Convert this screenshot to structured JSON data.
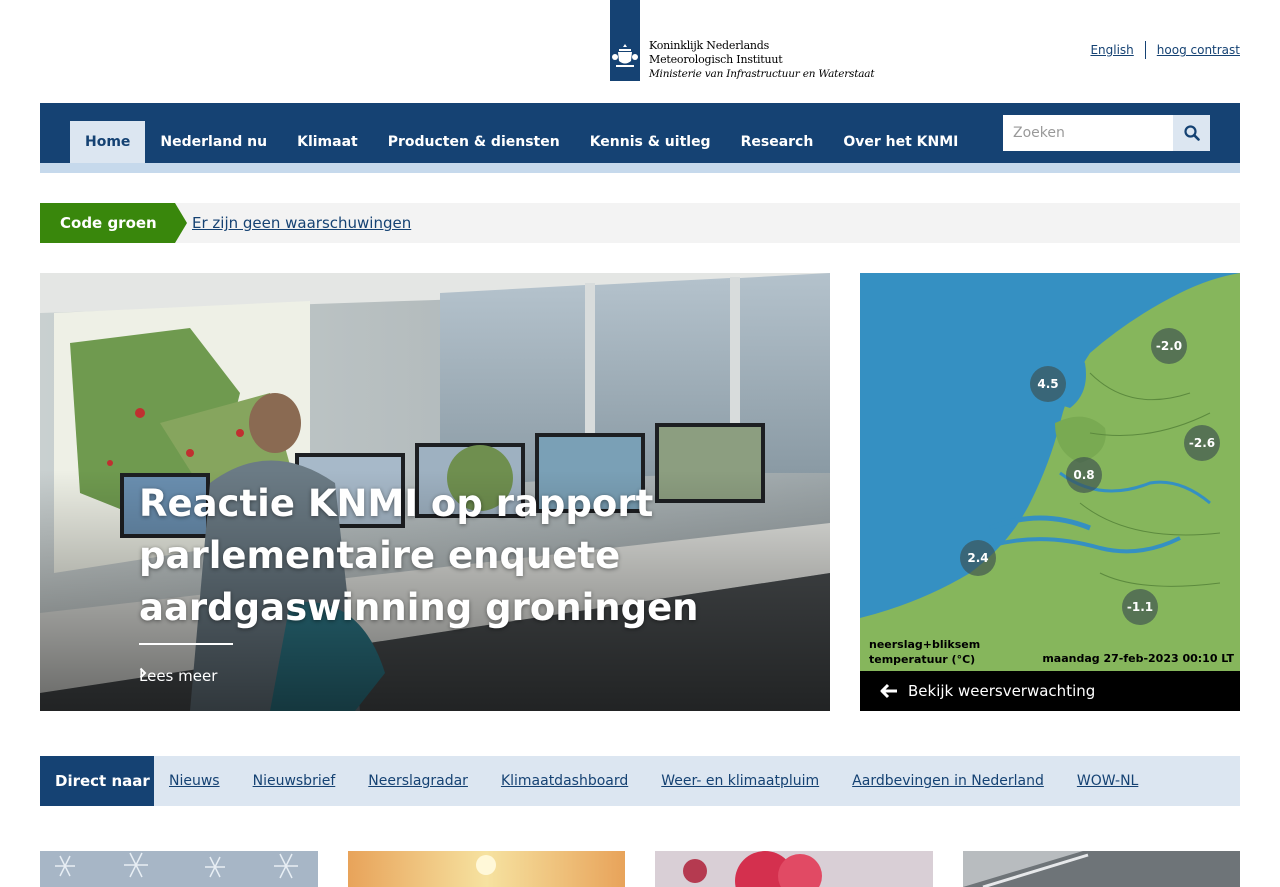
{
  "header": {
    "logo": {
      "line1": "Koninklijk Nederlands",
      "line2": "Meteorologisch Instituut",
      "line3": "Ministerie van Infrastructuur en Waterstaat"
    },
    "util_links": [
      "English",
      "hoog contrast"
    ]
  },
  "nav": {
    "items": [
      {
        "label": "Home"
      },
      {
        "label": "Nederland nu"
      },
      {
        "label": "Klimaat"
      },
      {
        "label": "Producten & diensten"
      },
      {
        "label": "Kennis & uitleg"
      },
      {
        "label": "Research"
      },
      {
        "label": "Over het KNMI"
      }
    ],
    "search_placeholder": "Zoeken",
    "colors": {
      "primary": "#154273",
      "active_bg": "#dce6f1"
    }
  },
  "warning": {
    "code": "Code groen",
    "text": "Er zijn geen waarschuwingen",
    "color": "#39870c"
  },
  "hero": {
    "title": "Reactie KNMI op rapport parlementaire enquete aardgaswinning groningen",
    "link": "Lees meer"
  },
  "map": {
    "values": [
      "-2.0",
      "4.5",
      "-2.6",
      "0.8",
      "2.4",
      "-1.1"
    ],
    "legend_line1": "neerslag+bliksem",
    "legend_line2": "temperatuur (°C)",
    "timestamp": "maandag 27-feb-2023 00:10 LT",
    "link": "Bekijk weersverwachting"
  },
  "direct": {
    "label": "Direct naar",
    "links": [
      "Nieuws",
      "Nieuwsbrief",
      "Neerslagradar",
      "Klimaatdashboard",
      "Weer- en klimaatpluim",
      "Aardbevingen in Nederland",
      "WOW-NL"
    ]
  }
}
